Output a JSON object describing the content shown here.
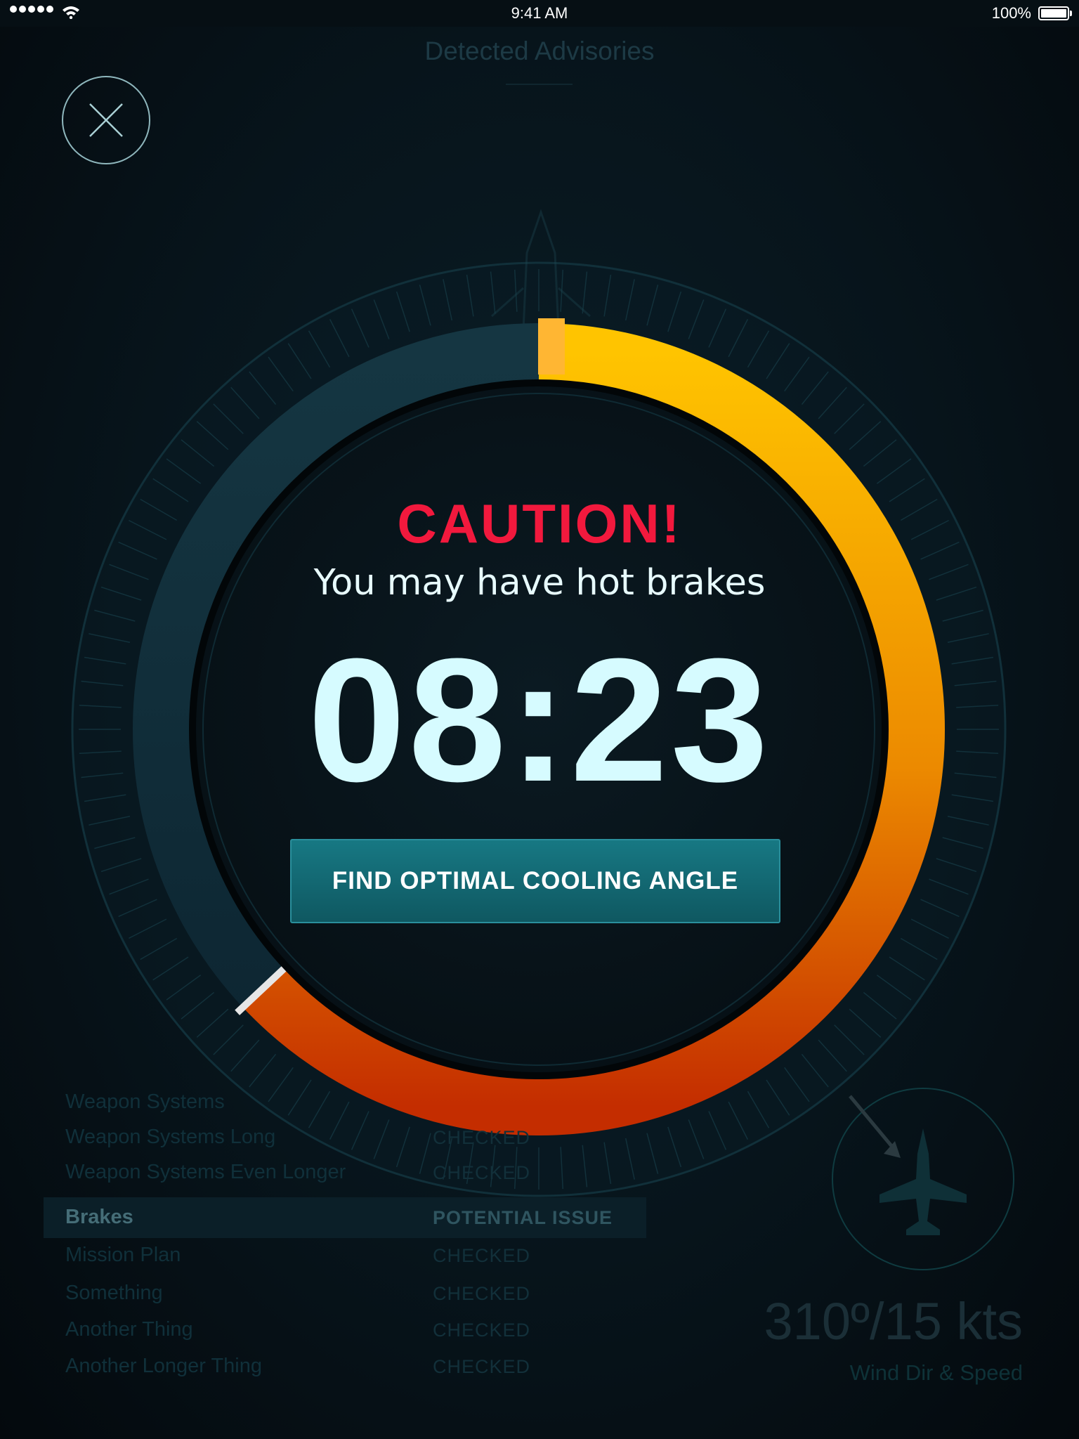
{
  "status_bar": {
    "time": "9:41 AM",
    "battery": "100%",
    "signal_icon": "signal-dots-icon",
    "wifi_icon": "wifi-icon",
    "battery_icon": "battery-icon"
  },
  "header": {
    "title": "Detected Advisories",
    "close_icon": "close-icon"
  },
  "alert": {
    "heading": "CAUTION!",
    "message": "You may have hot brakes",
    "timer": "08:23",
    "action_label": "FIND OPTIMAL COOLING ANGLE",
    "progress_fraction": 0.63,
    "colors": {
      "caution_text": "#f2193d",
      "ring_start": "#ffc400",
      "ring_end": "#c42d00",
      "ring_track": "#163541",
      "button": "#177883"
    }
  },
  "advisories": [
    {
      "name": "Weapon Systems",
      "status": "",
      "active": false
    },
    {
      "name": "Weapon Systems Long",
      "status": "CHECKED",
      "active": false
    },
    {
      "name": "Weapon Systems Even Longer",
      "status": "CHECKED",
      "active": false
    },
    {
      "name": "Brakes",
      "status": "POTENTIAL ISSUE",
      "active": true
    },
    {
      "name": "Mission Plan",
      "status": "CHECKED",
      "active": false
    },
    {
      "name": "Something",
      "status": "CHECKED",
      "active": false
    },
    {
      "name": "Another Thing",
      "status": "CHECKED",
      "active": false
    },
    {
      "name": "Another Longer Thing",
      "status": "CHECKED",
      "active": false
    }
  ],
  "wind": {
    "value": "310º/15 kts",
    "label": "Wind Dir & Speed",
    "aircraft_icon": "fighter-jet-icon",
    "arrow_icon": "wind-arrow-icon"
  }
}
